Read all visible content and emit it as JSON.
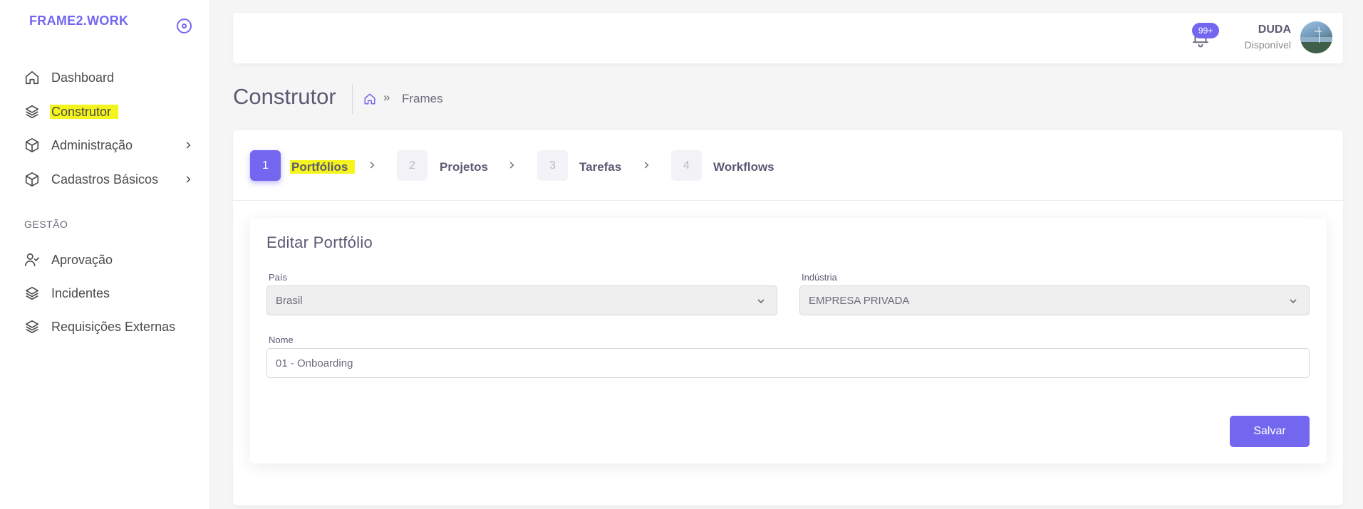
{
  "brand": "FRAME2.WORK",
  "sidebar": {
    "items": [
      {
        "label": "Dashboard",
        "icon": "home-icon"
      },
      {
        "label": "Construtor",
        "icon": "layers-icon",
        "highlighted": true
      },
      {
        "label": "Administração",
        "icon": "box-icon",
        "has_submenu": true
      },
      {
        "label": "Cadastros Básicos",
        "icon": "box-icon",
        "has_submenu": true
      }
    ],
    "section_title": "GESTÃO",
    "section_items": [
      {
        "label": "Aprovação",
        "icon": "user-check-icon"
      },
      {
        "label": "Incidentes",
        "icon": "layers-icon"
      },
      {
        "label": "Requisições Externas",
        "icon": "layers-icon"
      }
    ]
  },
  "header": {
    "notification_badge": "99+",
    "user_name": "DUDA",
    "user_status": "Disponível"
  },
  "page": {
    "title": "Construtor",
    "breadcrumb_separator": "»",
    "breadcrumb_current": "Frames"
  },
  "steps": [
    {
      "number": "1",
      "label": "Portfólios",
      "active": true
    },
    {
      "number": "2",
      "label": "Projetos",
      "active": false
    },
    {
      "number": "3",
      "label": "Tarefas",
      "active": false
    },
    {
      "number": "4",
      "label": "Workflows",
      "active": false
    }
  ],
  "form": {
    "title": "Editar Portfólio",
    "pais_label": "País",
    "pais_value": "Brasil",
    "industria_label": "Indústria",
    "industria_value": "EMPRESA PRIVADA",
    "nome_label": "Nome",
    "nome_value": "01 - Onboarding",
    "save_label": "Salvar"
  },
  "colors": {
    "accent": "#7367f0",
    "highlight": "#f5f51e"
  }
}
